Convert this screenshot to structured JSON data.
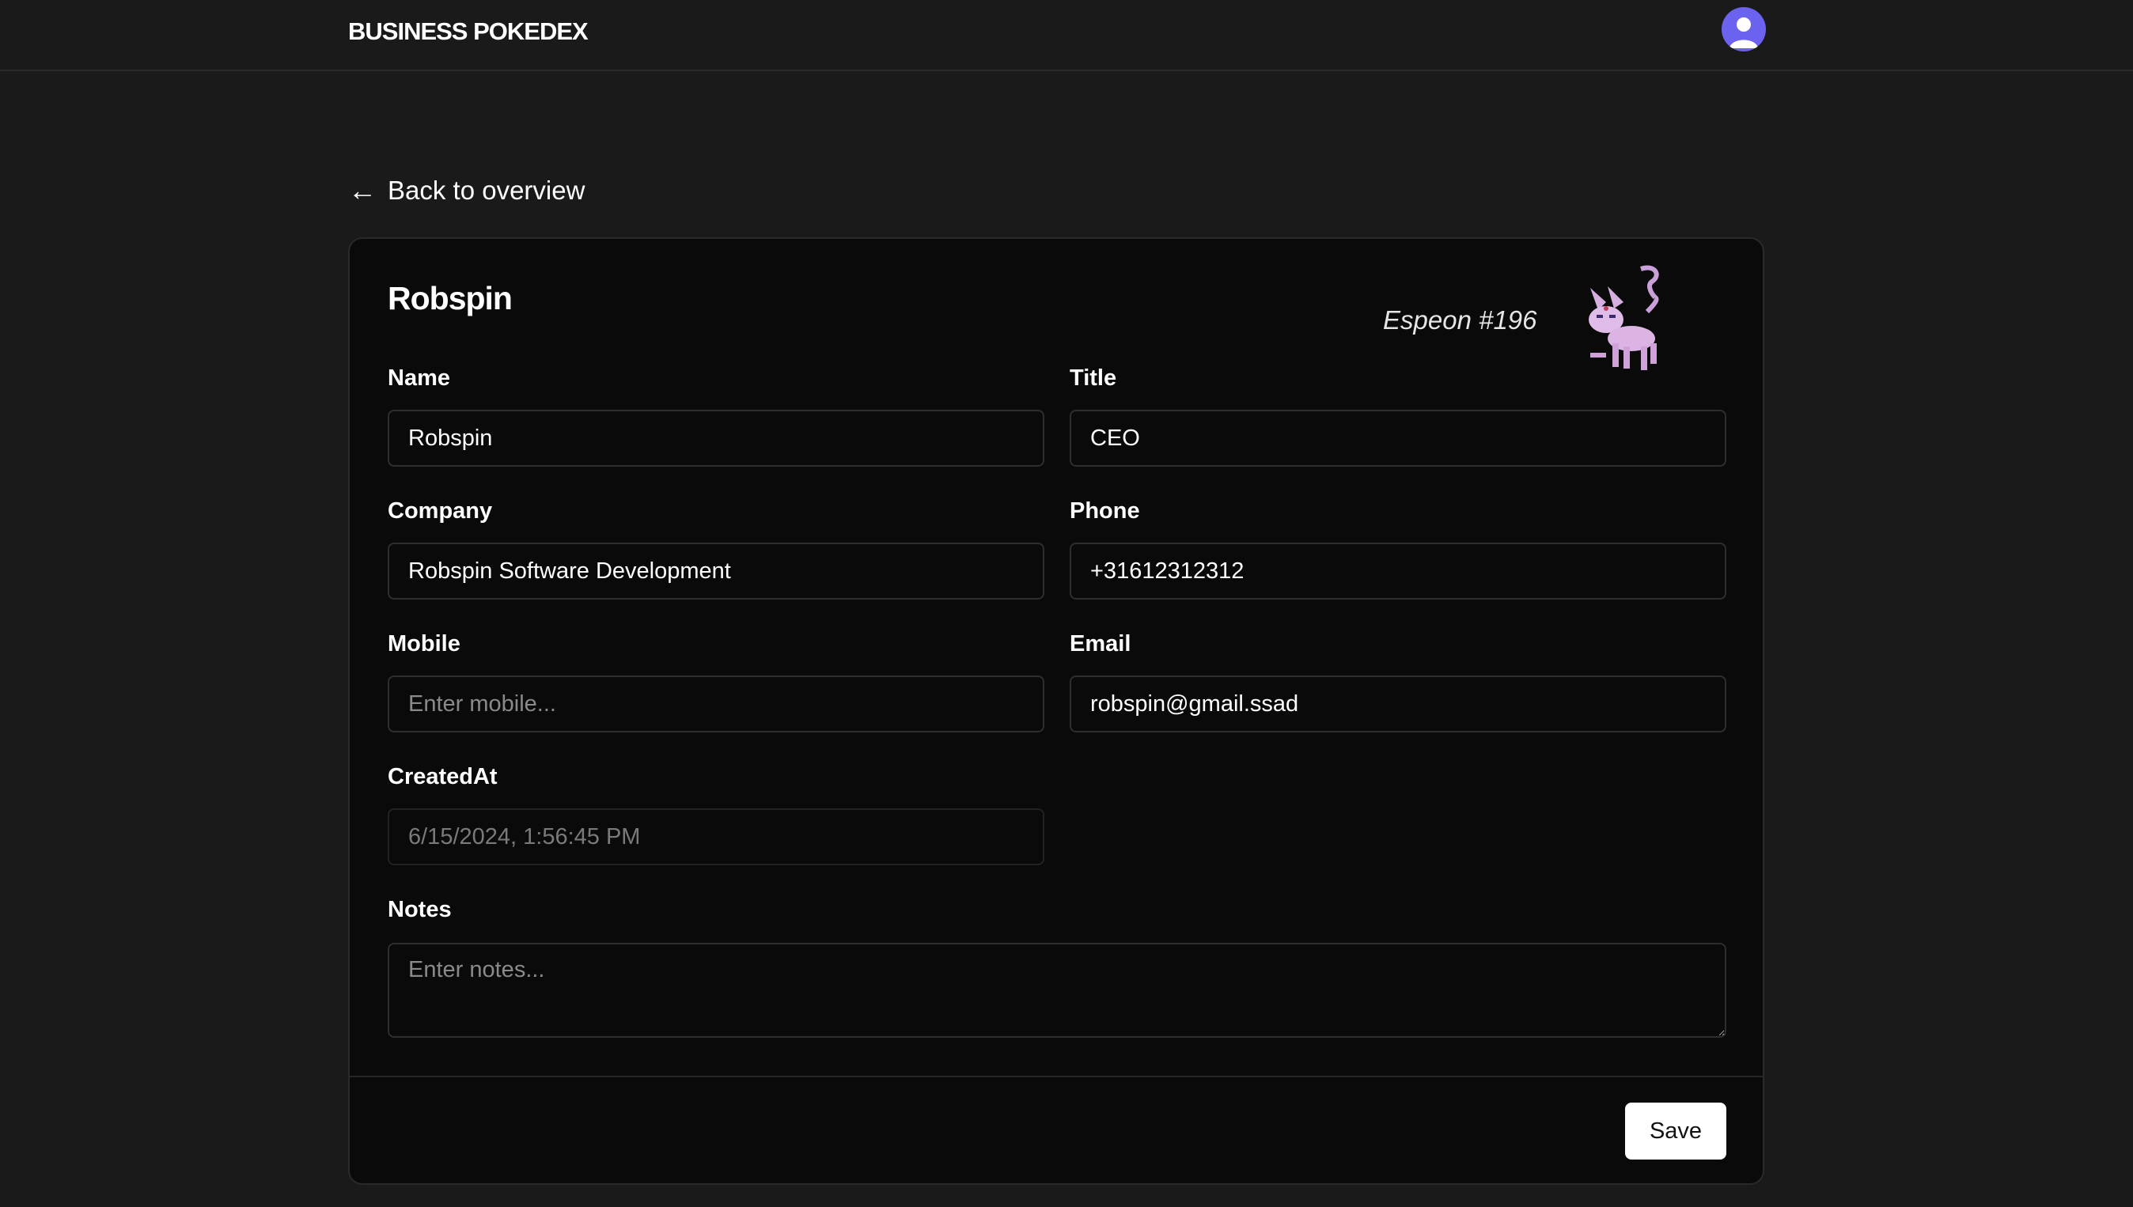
{
  "header": {
    "brand": "BUSINESS POKEDEX",
    "avatar_icon": "user-avatar-icon",
    "accent_color": "#6b63f0"
  },
  "nav": {
    "back_label": "Back to overview",
    "back_arrow": "←"
  },
  "card": {
    "title": "Robspin",
    "pokemon": {
      "label": "Espeon #196",
      "sprite_icon": "espeon-sprite"
    },
    "fields": {
      "name": {
        "label": "Name",
        "value": "Robspin",
        "placeholder": ""
      },
      "title": {
        "label": "Title",
        "value": "CEO",
        "placeholder": ""
      },
      "company": {
        "label": "Company",
        "value": "Robspin Software Development",
        "placeholder": ""
      },
      "phone": {
        "label": "Phone",
        "value": "+31612312312",
        "placeholder": ""
      },
      "mobile": {
        "label": "Mobile",
        "value": "",
        "placeholder": "Enter mobile..."
      },
      "email": {
        "label": "Email",
        "value": "robspin@gmail.ssad",
        "placeholder": ""
      },
      "created_at": {
        "label": "CreatedAt",
        "value": "6/15/2024, 1:56:45 PM",
        "placeholder": ""
      },
      "notes": {
        "label": "Notes",
        "value": "",
        "placeholder": "Enter notes..."
      }
    },
    "save_label": "Save"
  }
}
